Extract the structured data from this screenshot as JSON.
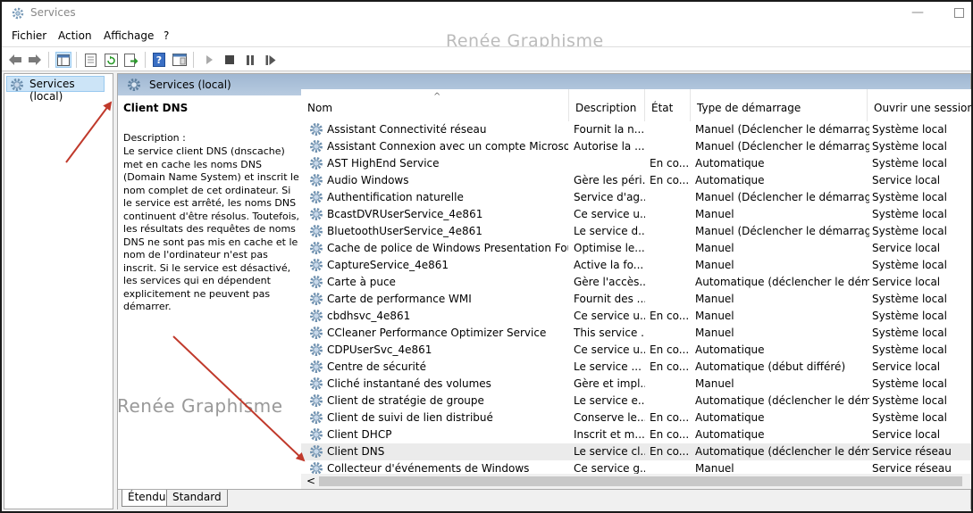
{
  "window": {
    "title": "Services"
  },
  "menu": [
    "Fichier",
    "Action",
    "Affichage",
    "?"
  ],
  "watermark": "Renée Graphisme",
  "tree": {
    "item": "Services (local)"
  },
  "pane": {
    "header": "Services (local)"
  },
  "details": {
    "title": "Client DNS",
    "label": "Description :",
    "text": "Le service client DNS (dnscache) met en cache les noms DNS (Domain Name System) et inscrit le nom complet de cet ordinateur. Si le service est arrêté, les noms DNS continuent d'être résolus. Toutefois, les résultats des requêtes de noms DNS ne sont pas mis en cache et le nom de l'ordinateur n'est pas inscrit. Si le service est désactivé, les services qui en dépendent explicitement ne peuvent pas démarrer."
  },
  "columns": [
    "Nom",
    "Description",
    "État",
    "Type de démarrage",
    "Ouvrir une session en tant que"
  ],
  "services": [
    {
      "name": "Assistant Connectivité réseau",
      "desc": "Fournit la n...",
      "state": "",
      "start": "Manuel (Déclencher le démarrage)",
      "logon": "Système local"
    },
    {
      "name": "Assistant Connexion avec un compte Microsoft",
      "desc": "Autorise la ...",
      "state": "",
      "start": "Manuel (Déclencher le démarrage)",
      "logon": "Système local"
    },
    {
      "name": "AST HighEnd Service",
      "desc": "",
      "state": "En co...",
      "start": "Automatique",
      "logon": "Système local"
    },
    {
      "name": "Audio Windows",
      "desc": "Gère les péri...",
      "state": "En co...",
      "start": "Automatique",
      "logon": "Service local"
    },
    {
      "name": "Authentification naturelle",
      "desc": "Service d'ag...",
      "state": "",
      "start": "Manuel (Déclencher le démarrage)",
      "logon": "Système local"
    },
    {
      "name": "BcastDVRUserService_4e861",
      "desc": "Ce service u...",
      "state": "",
      "start": "Manuel",
      "logon": "Système local"
    },
    {
      "name": "BluetoothUserService_4e861",
      "desc": "Le service d...",
      "state": "",
      "start": "Manuel (Déclencher le démarrage)",
      "logon": "Système local"
    },
    {
      "name": "Cache de police de Windows Presentation Found...",
      "desc": "Optimise le...",
      "state": "",
      "start": "Manuel",
      "logon": "Service local"
    },
    {
      "name": "CaptureService_4e861",
      "desc": "Active la fo...",
      "state": "",
      "start": "Manuel",
      "logon": "Système local"
    },
    {
      "name": "Carte à puce",
      "desc": "Gère l'accès...",
      "state": "",
      "start": "Automatique (déclencher le dém...",
      "logon": "Service local"
    },
    {
      "name": "Carte de performance WMI",
      "desc": "Fournit des ...",
      "state": "",
      "start": "Manuel",
      "logon": "Système local"
    },
    {
      "name": "cbdhsvc_4e861",
      "desc": "Ce service u...",
      "state": "En co...",
      "start": "Manuel",
      "logon": "Système local"
    },
    {
      "name": "CCleaner Performance Optimizer Service",
      "desc": "This service ...",
      "state": "",
      "start": "Manuel",
      "logon": "Système local"
    },
    {
      "name": "CDPUserSvc_4e861",
      "desc": "Ce service u...",
      "state": "En co...",
      "start": "Automatique",
      "logon": "Système local"
    },
    {
      "name": "Centre de sécurité",
      "desc": "Le service ...",
      "state": "En co...",
      "start": "Automatique (début différé)",
      "logon": "Service local"
    },
    {
      "name": "Cliché instantané des volumes",
      "desc": "Gère et impl...",
      "state": "",
      "start": "Manuel",
      "logon": "Système local"
    },
    {
      "name": "Client de stratégie de groupe",
      "desc": "Le service e...",
      "state": "",
      "start": "Automatique (déclencher le dém...",
      "logon": "Système local"
    },
    {
      "name": "Client de suivi de lien distribué",
      "desc": "Conserve le...",
      "state": "En co...",
      "start": "Automatique",
      "logon": "Système local"
    },
    {
      "name": "Client DHCP",
      "desc": "Inscrit et m...",
      "state": "En co...",
      "start": "Automatique",
      "logon": "Service local"
    },
    {
      "name": "Client DNS",
      "desc": "Le service cl...",
      "state": "En co...",
      "start": "Automatique (déclencher le dém...",
      "logon": "Service réseau"
    },
    {
      "name": "Collecteur d'événements de Windows",
      "desc": "Ce service g...",
      "state": "",
      "start": "Manuel",
      "logon": "Service réseau"
    }
  ],
  "selected_index": 19,
  "tabs": [
    "Étendu",
    "Standard"
  ]
}
